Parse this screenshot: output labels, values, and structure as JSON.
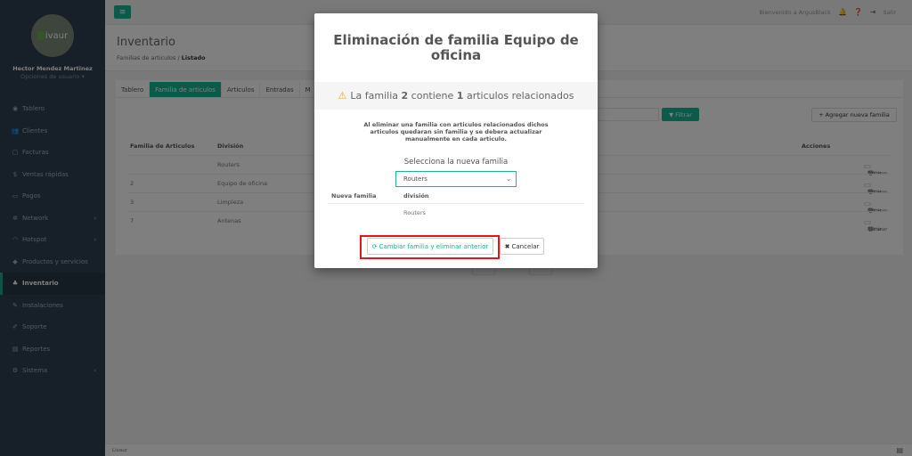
{
  "sidebar": {
    "logo_text": "ivaur",
    "user_name": "Hector Mendez Martinez",
    "user_options": "Opciones de usuario ▾",
    "items": [
      {
        "icon": "tachometer-icon",
        "glyph": "◉",
        "label": "Tablero",
        "chevron": ""
      },
      {
        "icon": "users-icon",
        "glyph": "👥",
        "label": "Clientes",
        "chevron": ""
      },
      {
        "icon": "file-icon",
        "glyph": "▢",
        "label": "Facturas",
        "chevron": ""
      },
      {
        "icon": "dollar-icon",
        "glyph": "$",
        "label": "Ventas rápidas",
        "chevron": ""
      },
      {
        "icon": "credit-card-icon",
        "glyph": "▭",
        "label": "Pagos",
        "chevron": ""
      },
      {
        "icon": "network-icon",
        "glyph": "✲",
        "label": "Network",
        "chevron": "‹"
      },
      {
        "icon": "wifi-icon",
        "glyph": "◠",
        "label": "Hotspot",
        "chevron": "‹"
      },
      {
        "icon": "tag-icon",
        "glyph": "◆",
        "label": "Productos y servicios",
        "chevron": ""
      },
      {
        "icon": "cubes-icon",
        "glyph": "♣",
        "label": "Inventario",
        "chevron": "",
        "active": true
      },
      {
        "icon": "wrench-icon",
        "glyph": "✎",
        "label": "Instalaciones",
        "chevron": ""
      },
      {
        "icon": "support-icon",
        "glyph": "✐",
        "label": "Soporte",
        "chevron": ""
      },
      {
        "icon": "chart-icon",
        "glyph": "▤",
        "label": "Reportes",
        "chevron": ""
      },
      {
        "icon": "cogs-icon",
        "glyph": "⚙",
        "label": "Sistema",
        "chevron": "‹"
      }
    ]
  },
  "topbar": {
    "welcome": "Bienvenido a ArgusBlack",
    "logout": "Salir"
  },
  "heading": {
    "title": "Inventario",
    "crumb_parent": "Familias de articulos",
    "crumb_sep": "/",
    "crumb_current": "Listado"
  },
  "tabs": [
    "Tablero",
    "Familia de articulos",
    "Articulos",
    "Entradas",
    "M"
  ],
  "filter_label": "Filtrar",
  "add_family_label": "Agregar nueva familia",
  "table": {
    "headers": [
      "Familia de Articulos",
      "División",
      "Acciones"
    ],
    "rows": [
      {
        "id": "",
        "division": "Routers"
      },
      {
        "id": "2",
        "division": "Equipo de oficina"
      },
      {
        "id": "3",
        "division": "Limpieza"
      },
      {
        "id": "7",
        "division": "Antenas"
      }
    ],
    "edit_label": "Editar",
    "delete_label": "Eliminar"
  },
  "footer": {
    "text": "Livaur"
  },
  "modal": {
    "title": "Eliminación de familia Equipo de oficina",
    "warning_prefix": "La familia ",
    "warning_family": "2",
    "warning_mid": " contiene ",
    "warning_count": "1",
    "warning_suffix": " articulos relacionados",
    "message": "Al eliminar una familia con articulos relacionados dichos articulos quedaran sin familia y se debera actualizar manualmente en cada articulo.",
    "select_label": "Selecciona la nueva familia",
    "select_value": "Routers",
    "col_new_family": "Nueva familia",
    "col_division": "división",
    "row_division": "Routers",
    "confirm_label": "Cambiar familia y eliminar anterior",
    "cancel_label": "Cancelar"
  },
  "colors": {
    "accent": "#1ab394",
    "sidebar": "#2f4050",
    "highlight": "#e0181e",
    "warning": "#f0a030"
  }
}
